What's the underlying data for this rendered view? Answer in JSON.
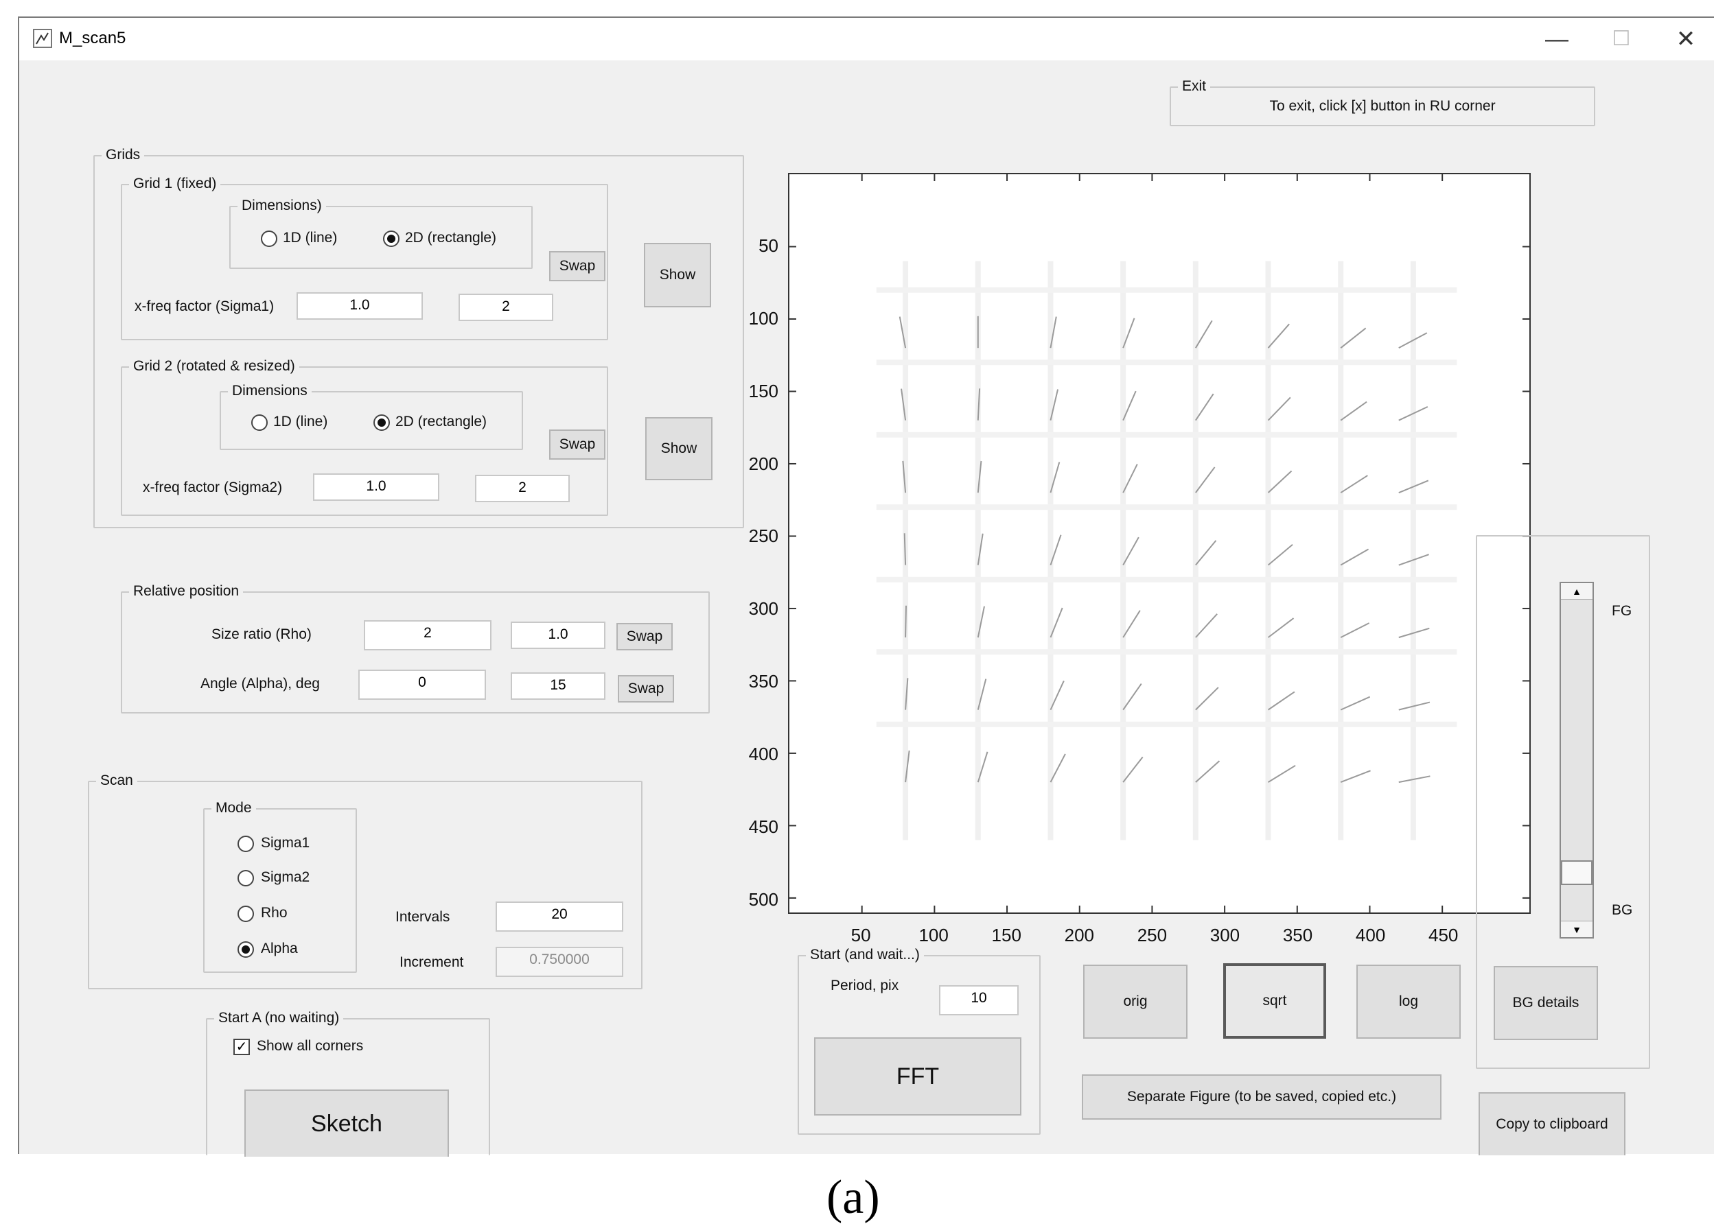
{
  "window": {
    "title": "M_scan5",
    "minimize": "—",
    "maximize": "☐",
    "close": "✕"
  },
  "exit": {
    "title": "Exit",
    "text": "To exit, click [x] button in RU corner"
  },
  "grids": {
    "title": "Grids",
    "grid1": {
      "title": "Grid 1 (fixed)",
      "dimensions_title": "Dimensions)",
      "opt1": "1D (line)",
      "opt2": "2D (rectangle)",
      "swap": "Swap",
      "show": "Show",
      "freq_label": "x-freq factor (Sigma1)",
      "freq_value": "1.0",
      "freq_value2": "2"
    },
    "grid2": {
      "title": "Grid 2 (rotated & resized)",
      "dimensions_title": "Dimensions",
      "opt1": "1D (line)",
      "opt2": "2D (rectangle)",
      "swap": "Swap",
      "show": "Show",
      "freq_label": "x-freq factor (Sigma2)",
      "freq_value": "1.0",
      "freq_value2": "2"
    }
  },
  "relpos": {
    "title": "Relative position",
    "size_label": "Size ratio (Rho)",
    "size_value": "2",
    "size_value2": "1.0",
    "size_swap": "Swap",
    "angle_label": "Angle (Alpha), deg",
    "angle_value": "0",
    "angle_value2": "15",
    "angle_swap": "Swap"
  },
  "scan": {
    "title": "Scan",
    "mode_title": "Mode",
    "modes": [
      "Sigma1",
      "Sigma2",
      "Rho",
      "Alpha"
    ],
    "selected_mode": "Alpha",
    "intervals_label": "Intervals",
    "intervals_value": "20",
    "increment_label": "Increment",
    "increment_value": "0.750000"
  },
  "startA": {
    "title": "Start A (no waiting)",
    "show_corners": "Show all corners",
    "sketch": "Sketch"
  },
  "startFFT": {
    "title": "Start (and wait...)",
    "period_label": "Period, pix",
    "period_value": "10",
    "fft": "FFT"
  },
  "display": {
    "orig": "orig",
    "sqrt": "sqrt",
    "log": "log",
    "selected": "sqrt",
    "separate": "Separate Figure (to be saved, copied etc.)",
    "bg_details": "BG details",
    "copy": "Copy to clipboard",
    "fg_label": "FG",
    "bg_label": "BG",
    "slider_level": 0.12
  },
  "axes": {
    "yticks": [
      "50",
      "100",
      "150",
      "200",
      "250",
      "300",
      "350",
      "400",
      "450",
      "500"
    ],
    "xticks": [
      "50",
      "100",
      "150",
      "200",
      "250",
      "300",
      "350",
      "400",
      "450"
    ],
    "xlim": [
      0,
      510
    ],
    "ylim": [
      0,
      510
    ]
  },
  "caption": "(a)"
}
